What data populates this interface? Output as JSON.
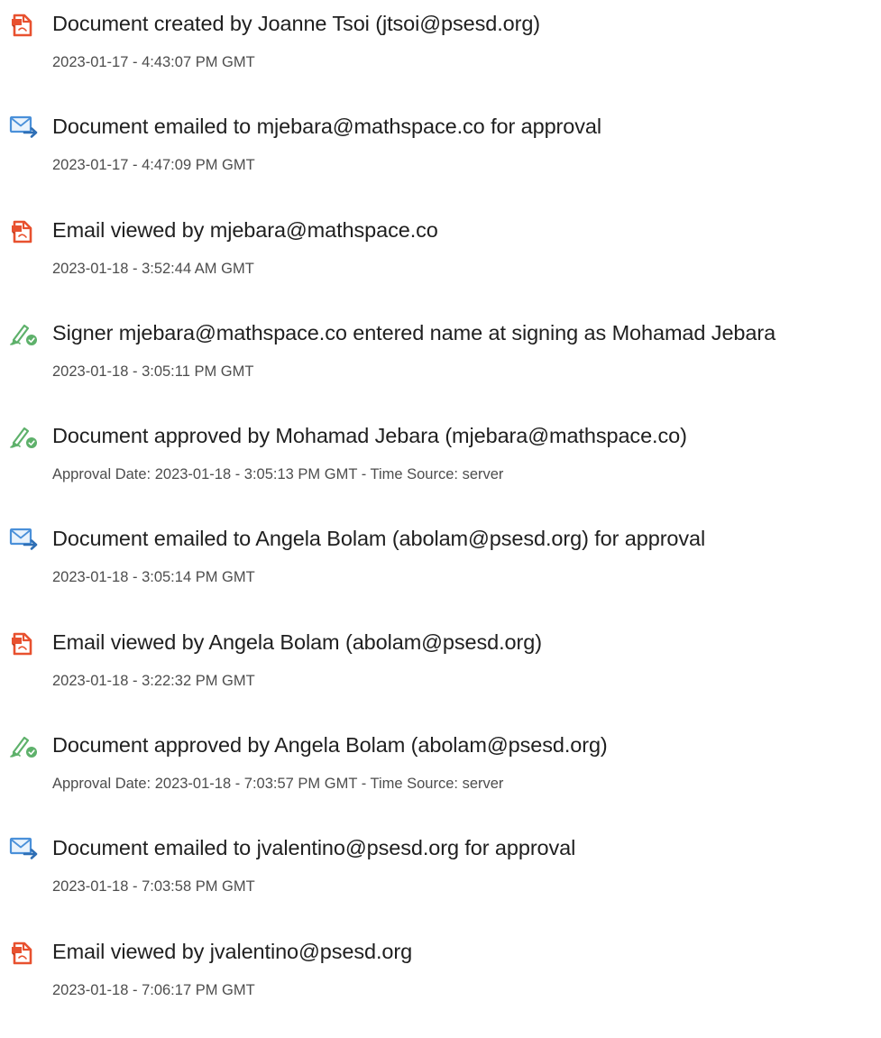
{
  "colors": {
    "doc_icon": "#e8512f",
    "email_icon": "#4a90d9",
    "sign_icon": "#5eb16b",
    "title_text": "#1f1f1f",
    "sub_text": "#4d4d4d"
  },
  "entries": [
    {
      "icon": "document-icon",
      "title": "Document created by Joanne Tsoi (jtsoi@psesd.org)",
      "sub": "2023-01-17 - 4:43:07 PM GMT"
    },
    {
      "icon": "email-icon",
      "title": "Document emailed to mjebara@mathspace.co for approval",
      "sub": "2023-01-17 - 4:47:09 PM GMT"
    },
    {
      "icon": "document-icon",
      "title": "Email viewed by mjebara@mathspace.co",
      "sub": "2023-01-18 - 3:52:44 AM GMT"
    },
    {
      "icon": "signature-icon",
      "title": "Signer mjebara@mathspace.co entered name at signing as Mohamad Jebara",
      "sub": "2023-01-18 - 3:05:11 PM GMT"
    },
    {
      "icon": "signature-icon",
      "title": "Document approved by Mohamad Jebara (mjebara@mathspace.co)",
      "sub": "Approval Date: 2023-01-18 - 3:05:13 PM GMT - Time Source: server"
    },
    {
      "icon": "email-icon",
      "title": "Document emailed to Angela Bolam (abolam@psesd.org) for approval",
      "sub": "2023-01-18 - 3:05:14 PM GMT"
    },
    {
      "icon": "document-icon",
      "title": "Email viewed by Angela Bolam (abolam@psesd.org)",
      "sub": "2023-01-18 - 3:22:32 PM GMT"
    },
    {
      "icon": "signature-icon",
      "title": "Document approved by Angela Bolam (abolam@psesd.org)",
      "sub": "Approval Date: 2023-01-18 - 7:03:57 PM GMT - Time Source: server"
    },
    {
      "icon": "email-icon",
      "title": "Document emailed to jvalentino@psesd.org for approval",
      "sub": "2023-01-18 - 7:03:58 PM GMT"
    },
    {
      "icon": "document-icon",
      "title": "Email viewed by jvalentino@psesd.org",
      "sub": "2023-01-18 - 7:06:17 PM GMT"
    }
  ]
}
